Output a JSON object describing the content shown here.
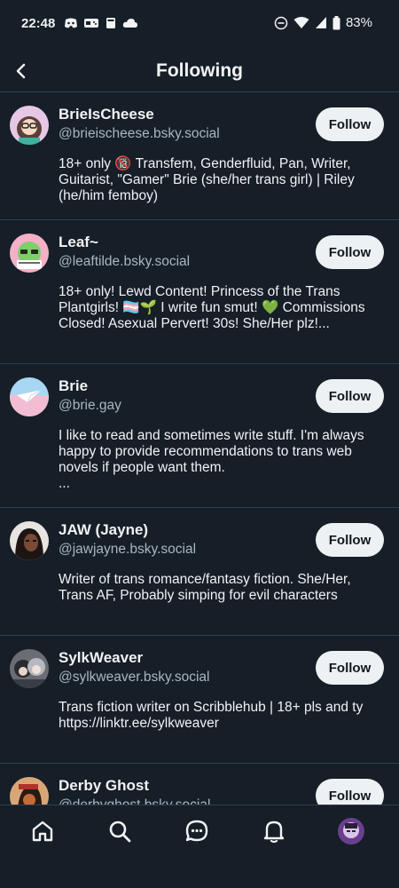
{
  "status_bar": {
    "time": "22:48",
    "battery": "83%",
    "icons": [
      "discord-icon",
      "controller-icon",
      "book-icon",
      "cloud-icon",
      "dnd-icon",
      "wifi-icon",
      "signal-icon",
      "battery-icon"
    ]
  },
  "header": {
    "title": "Following",
    "back_icon": "chevron-left-icon"
  },
  "follows": [
    {
      "name": "BrieIsCheese",
      "handle": "@brieischeese.bsky.social",
      "bio": "18+ only 🔞 Transfem, Genderfluid, Pan, Writer, Guitarist, \"Gamer\" Brie (she/her trans girl) | Riley (he/him femboy)",
      "button": "Follow"
    },
    {
      "name": "Leaf~",
      "handle": "@leaftilde.bsky.social",
      "bio": "18+ only! Lewd Content! Princess of the Trans Plantgirls! 🏳️‍⚧️🌱 I write fun smut! 💚 Commissions Closed! Asexual Pervert! 30s! She/Her plz!...",
      "button": "Follow"
    },
    {
      "name": "Brie",
      "handle": "@brie.gay",
      "bio": "I like to read and sometimes write stuff. I'm always happy to provide recommendations to trans web novels if people want them.\n...",
      "button": "Follow"
    },
    {
      "name": "JAW (Jayne)",
      "handle": "@jawjayne.bsky.social",
      "bio": "Writer of trans romance/fantasy fiction. She/Her, Trans AF, Probably simping for evil characters",
      "button": "Follow"
    },
    {
      "name": "SylkWeaver",
      "handle": "@sylkweaver.bsky.social",
      "bio": "Trans fiction writer on Scribblehub | 18+ pls and ty\nhttps://linktr.ee/sylkweaver",
      "button": "Follow"
    },
    {
      "name": "Derby Ghost",
      "handle": "@derbyghost.bsky.social",
      "bio": "",
      "button": "Follow"
    }
  ],
  "bottom_nav": {
    "items": [
      "home-icon",
      "search-icon",
      "chat-icon",
      "notifications-icon",
      "profile-avatar"
    ]
  },
  "colors": {
    "background": "#161e27",
    "divider": "#2e4052",
    "secondary_text": "#a8b6c4",
    "button_bg": "#eef1f4"
  }
}
